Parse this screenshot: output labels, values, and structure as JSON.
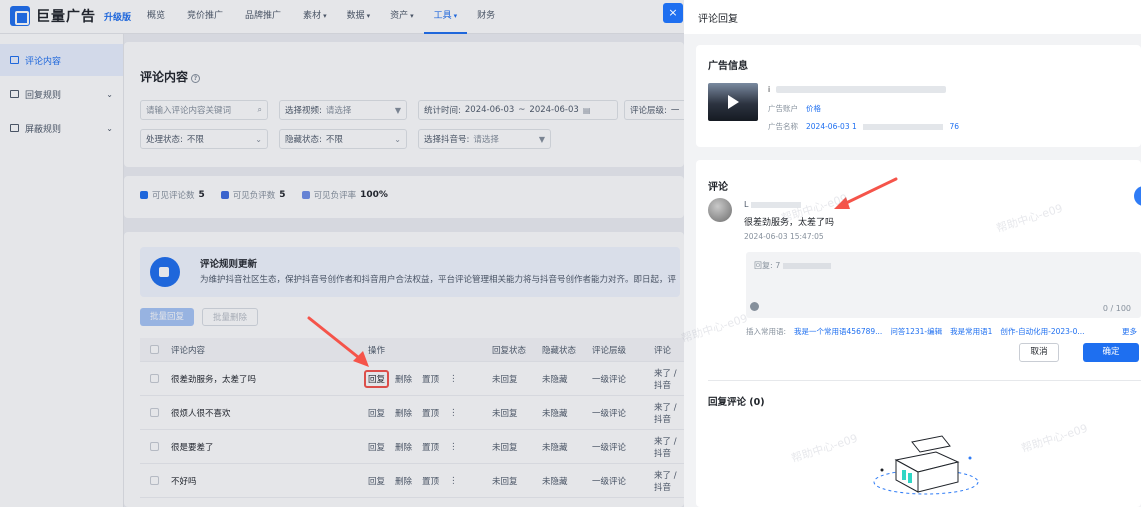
{
  "brand": {
    "logo_text": "巨量广告",
    "badge": "升级版"
  },
  "nav": [
    {
      "label": "概览",
      "caret": ""
    },
    {
      "label": "竞价推广",
      "caret": ""
    },
    {
      "label": "品牌推广",
      "caret": ""
    },
    {
      "label": "素材",
      "caret": "▾"
    },
    {
      "label": "数据",
      "caret": "▾"
    },
    {
      "label": "资产",
      "caret": "▾"
    },
    {
      "label": "工具",
      "caret": "▾"
    },
    {
      "label": "财务",
      "caret": ""
    }
  ],
  "sidebar": {
    "items": [
      {
        "label": "评论内容",
        "caret": ""
      },
      {
        "label": "回复规则",
        "caret": "⌄"
      },
      {
        "label": "屏蔽规则",
        "caret": "⌄"
      }
    ]
  },
  "page": {
    "title": "评论内容",
    "help": "?"
  },
  "filters": {
    "search_placeholder": "请输入评论内容关键词",
    "video_label": "选择视频:",
    "video_value": "请选择",
    "stat_time_label": "统计时间:",
    "date_start": "2024-06-03",
    "date_sep": "~",
    "date_end": "2024-06-03",
    "level_label": "评论层级:",
    "level_value": "一",
    "status_label": "处理状态:",
    "status_value": "不限",
    "hidden_label": "隐藏状态:",
    "hidden_value": "不限",
    "account_label": "选择抖音号:",
    "account_value": "请选择"
  },
  "stats": [
    {
      "label": "可见评论数",
      "value": "5",
      "color": "#1e6ff0"
    },
    {
      "label": "可见负评数",
      "value": "5",
      "color": "#3d6be0"
    },
    {
      "label": "可见负评率",
      "value": "100%",
      "color": "#6f8fe8"
    }
  ],
  "notice": {
    "title": "评论规则更新",
    "text": "为维护抖音社区生态，保护抖音号创作者和抖音用户合法权益，平台评论管理相关能力将与抖音号创作者能力对齐。即日起，评"
  },
  "batch": {
    "reply": "批量回复",
    "delete": "批量删除"
  },
  "table": {
    "headers": {
      "content": "评论内容",
      "ops": "操作",
      "reply_status": "回复状态",
      "hidden_status": "隐藏状态",
      "level": "评论层级",
      "more": "评论"
    },
    "rows": [
      {
        "content": "很差劲服务，太差了吗",
        "reply": "回复",
        "delete": "删除",
        "pin": "置顶",
        "menu": "⋮",
        "reply_status": "未回复",
        "hidden_status": "未隐藏",
        "level": "一级评论",
        "extra": "来了 / 抖音"
      },
      {
        "content": "很烦人很不喜欢",
        "reply": "回复",
        "delete": "删除",
        "pin": "置顶",
        "menu": "⋮",
        "reply_status": "未回复",
        "hidden_status": "未隐藏",
        "level": "一级评论",
        "extra": "来了 / 抖音"
      },
      {
        "content": "很是要差了",
        "reply": "回复",
        "delete": "删除",
        "pin": "置顶",
        "menu": "⋮",
        "reply_status": "未回复",
        "hidden_status": "未隐藏",
        "level": "一级评论",
        "extra": "来了 / 抖音"
      },
      {
        "content": "不好吗",
        "reply": "回复",
        "delete": "删除",
        "pin": "置顶",
        "menu": "⋮",
        "reply_status": "未回复",
        "hidden_status": "未隐藏",
        "level": "一级评论",
        "extra": "来了 / 抖音"
      }
    ]
  },
  "drawer": {
    "title": "评论回复",
    "close": "×",
    "ad_info": {
      "title": "广告信息",
      "name_value": "i",
      "account_label": "广告账户",
      "account_value": "价格",
      "ad_name_label": "广告名称",
      "ad_name_value": "2024-06-03 1",
      "ad_name_suffix": "76"
    },
    "comment": {
      "title": "评论",
      "user": "L",
      "text": "很差劲服务，太差了吗",
      "time": "2024-06-03 15:47:05"
    },
    "reply": {
      "prefix": "回复: 7",
      "counter": "0 / 100",
      "templates_label": "插入常用语:",
      "templates": [
        "我是一个常用语456789...",
        "问答1231-编辑",
        "我是常用语1",
        "创作-自动化用-2023-0..."
      ],
      "more": "更多",
      "cancel": "取消",
      "confirm": "确定"
    },
    "replies": {
      "title": "回复评论 (0)"
    }
  },
  "watermark": "帮助中心-e09",
  "colors": {
    "accent": "#1e6ff0",
    "highlight": "#f5544a"
  }
}
